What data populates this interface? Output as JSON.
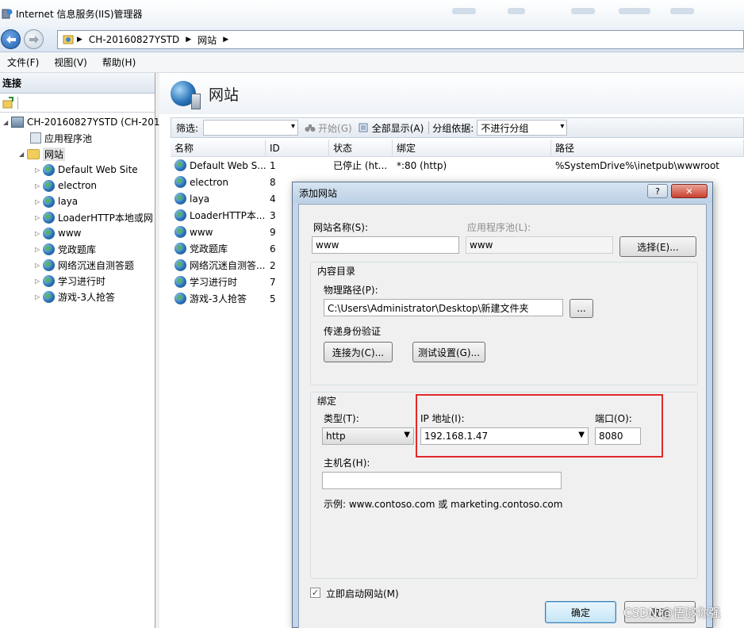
{
  "window": {
    "title": "Internet 信息服务(IIS)管理器"
  },
  "address": {
    "crumbs": [
      "CH-20160827YSTD",
      "网站"
    ]
  },
  "menu": {
    "items": [
      "文件(F)",
      "视图(V)",
      "帮助(H)"
    ]
  },
  "connections": {
    "header": "连接",
    "server_label": "CH-20160827YSTD (CH-201",
    "app_pools_label": "应用程序池",
    "sites_label": "网站",
    "sites": [
      "Default Web Site",
      "electron",
      "laya",
      "LoaderHTTP本地或网",
      "www",
      "党政题库",
      "网络沉迷自测答题",
      "学习进行时",
      "游戏-3人抢答"
    ]
  },
  "main": {
    "title": "网站",
    "filter_label": "筛选:",
    "start_label": "开始(G)",
    "show_all_label": "全部显示(A)",
    "group_by_label": "分组依据:",
    "group_by_value": "不进行分组",
    "columns": [
      "名称",
      "ID",
      "状态",
      "绑定",
      "路径"
    ],
    "rows": [
      {
        "name": "Default Web S...",
        "id": "1",
        "status": "已停止 (ht...",
        "binding": "*:80 (http)",
        "path": "%SystemDrive%\\inetpub\\wwwroot"
      },
      {
        "name": "electron",
        "id": "8",
        "status": "",
        "binding": "",
        "path": ""
      },
      {
        "name": "laya",
        "id": "4",
        "status": "",
        "binding": "",
        "path": ""
      },
      {
        "name": "LoaderHTTP本...",
        "id": "3",
        "status": "",
        "binding": "",
        "path": ""
      },
      {
        "name": "www",
        "id": "9",
        "status": "",
        "binding": "",
        "path": ""
      },
      {
        "name": "党政题库",
        "id": "6",
        "status": "",
        "binding": "",
        "path": ""
      },
      {
        "name": "网络沉迷自测答...",
        "id": "2",
        "status": "",
        "binding": "",
        "path": ""
      },
      {
        "name": "学习进行时",
        "id": "7",
        "status": "",
        "binding": "",
        "path": ""
      },
      {
        "name": "游戏-3人抢答",
        "id": "5",
        "status": "",
        "binding": "",
        "path": ""
      }
    ]
  },
  "dialog": {
    "title": "添加网站",
    "help": "?",
    "close": "✕",
    "site_name_label": "网站名称(S):",
    "site_name_value": "www",
    "app_pool_label": "应用程序池(L):",
    "app_pool_value": "www",
    "select_button": "选择(E)...",
    "content_dir_label": "内容目录",
    "physical_path_label": "物理路径(P):",
    "physical_path_value": "C:\\Users\\Administrator\\Desktop\\新建文件夹",
    "browse_button": "...",
    "pass_auth_label": "传递身份验证",
    "connect_as_button": "连接为(C)...",
    "test_settings_button": "测试设置(G)...",
    "binding_label": "绑定",
    "type_label": "类型(T):",
    "type_value": "http",
    "ip_label": "IP 地址(I):",
    "ip_value": "192.168.1.47",
    "port_label": "端口(O):",
    "port_value": "8080",
    "host_label": "主机名(H):",
    "host_value": "",
    "example_text": "示例: www.contoso.com 或 marketing.contoso.com",
    "start_now_label": "立即启动网站(M)",
    "start_now_checked": true,
    "ok_button": "确定",
    "cancel_button": "取消"
  },
  "watermark": "CSDN @悟够你强"
}
